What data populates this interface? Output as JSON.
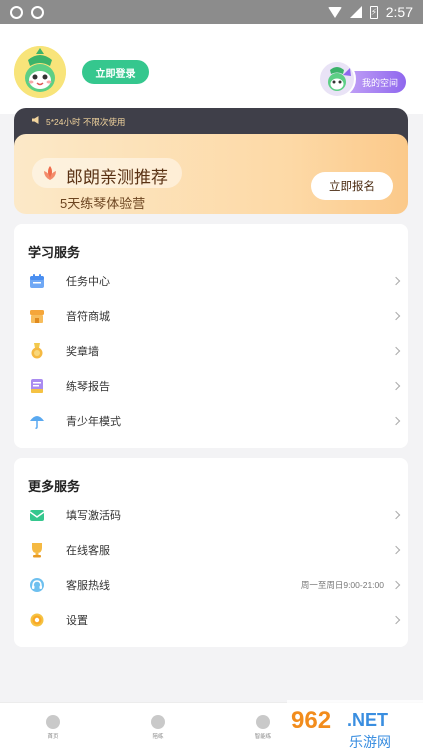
{
  "status_bar": {
    "time": "2:57"
  },
  "header": {
    "login_label": "立即登录",
    "space_label": "我的空间"
  },
  "vip": {
    "notice": "5*24小时 不限次使用",
    "title": "郎朗亲测推荐",
    "subtitle": "5天练琴体验营",
    "signup_label": "立即报名"
  },
  "study_services": {
    "title": "学习服务",
    "items": [
      {
        "label": "任务中心",
        "icon": "calendar-icon"
      },
      {
        "label": "音符商城",
        "icon": "shop-icon"
      },
      {
        "label": "奖章墙",
        "icon": "medal-icon"
      },
      {
        "label": "练琴报告",
        "icon": "report-icon"
      },
      {
        "label": "青少年模式",
        "icon": "umbrella-icon"
      }
    ]
  },
  "more_services": {
    "title": "更多服务",
    "items": [
      {
        "label": "填写激活码",
        "icon": "envelope-icon",
        "extra": ""
      },
      {
        "label": "在线客服",
        "icon": "trophy-icon",
        "extra": ""
      },
      {
        "label": "客服热线",
        "icon": "headset-icon",
        "extra": "周一至周日9:00-21:00"
      },
      {
        "label": "设置",
        "icon": "gear-icon",
        "extra": ""
      }
    ]
  },
  "bottom_nav": {
    "items": [
      {
        "label": "首页"
      },
      {
        "label": "陪练"
      },
      {
        "label": "智能练"
      }
    ]
  },
  "watermark": {
    "number": "962",
    "suffix": ".NET",
    "text": "乐游网"
  },
  "colors": {
    "accent_green": "#35c78e",
    "space_purple": "#8f67ee",
    "vip_dark": "#3f3f49",
    "vip_gold": "#fdd9a6"
  }
}
